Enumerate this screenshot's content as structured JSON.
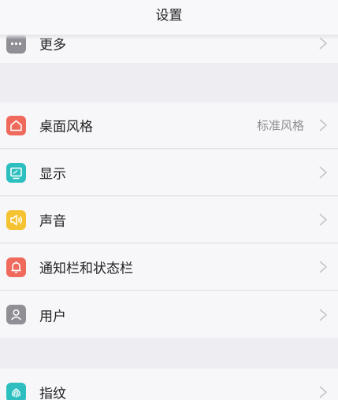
{
  "header": {
    "title": "设置"
  },
  "group1": [
    {
      "label": "更多",
      "icon": "more-icon",
      "color": "#8f8f95"
    }
  ],
  "group2": [
    {
      "label": "桌面风格",
      "value": "标准风格",
      "icon": "home-icon",
      "color": "#ef6a5c"
    },
    {
      "label": "显示",
      "icon": "display-icon",
      "color": "#2dbfbf"
    },
    {
      "label": "声音",
      "icon": "sound-icon",
      "color": "#f5c332"
    },
    {
      "label": "通知栏和状态栏",
      "icon": "bell-icon",
      "color": "#ef6a5c"
    },
    {
      "label": "用户",
      "icon": "user-icon",
      "color": "#8f8f95"
    }
  ],
  "group3": [
    {
      "label": "指纹",
      "icon": "fingerprint-icon",
      "color": "#2dbfbf"
    }
  ]
}
